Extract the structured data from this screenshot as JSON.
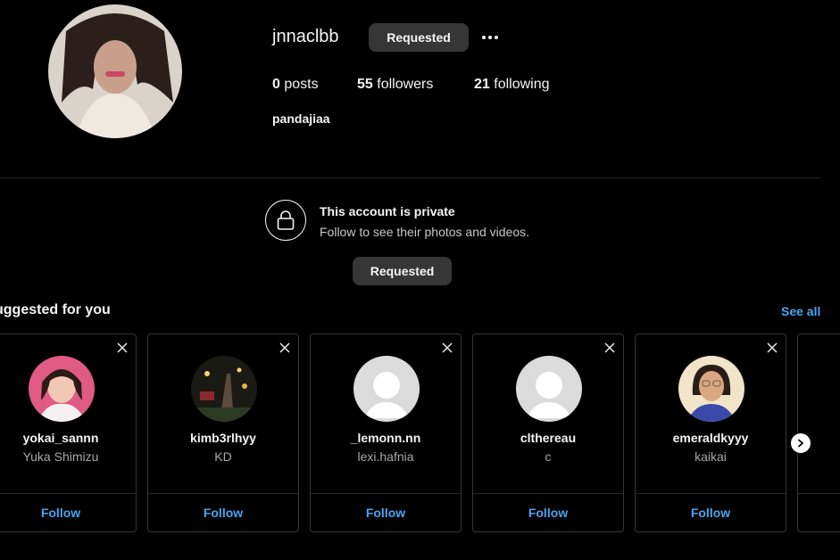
{
  "profile": {
    "username": "jnnaclbb",
    "follow_button": "Requested",
    "posts_count": "0",
    "posts_label": "posts",
    "followers_count": "55",
    "followers_label": "followers",
    "following_count": "21",
    "following_label": "following",
    "full_name": "pandajiaa"
  },
  "private_notice": {
    "title": "This account is private",
    "subtitle": "Follow to see their photos and videos.",
    "button": "Requested"
  },
  "suggestions": {
    "title": "uggested for you",
    "see_all": "See all",
    "cards": [
      {
        "username": "yokai_sannn",
        "name": "Yuka Shimizu",
        "follow": "Follow",
        "avatar": "photo"
      },
      {
        "username": "kimb3rlhyy",
        "name": "KD",
        "follow": "Follow",
        "avatar": "photo"
      },
      {
        "username": "_lemonn.nn",
        "name": "lexi.hafnia",
        "follow": "Follow",
        "avatar": "default-avatar"
      },
      {
        "username": "clthereau",
        "name": "c",
        "follow": "Follow",
        "avatar": "default-avatar"
      },
      {
        "username": "emeraldkyyy",
        "name": "kaikai",
        "follow": "Follow",
        "avatar": "photo"
      }
    ]
  },
  "colors": {
    "background": "#000000",
    "button_gray": "#363636",
    "link_blue": "#4aa3f0",
    "border": "#363636"
  },
  "icons": [
    "more-options-icon",
    "lock-icon",
    "close-icon",
    "chevron-right-icon"
  ]
}
